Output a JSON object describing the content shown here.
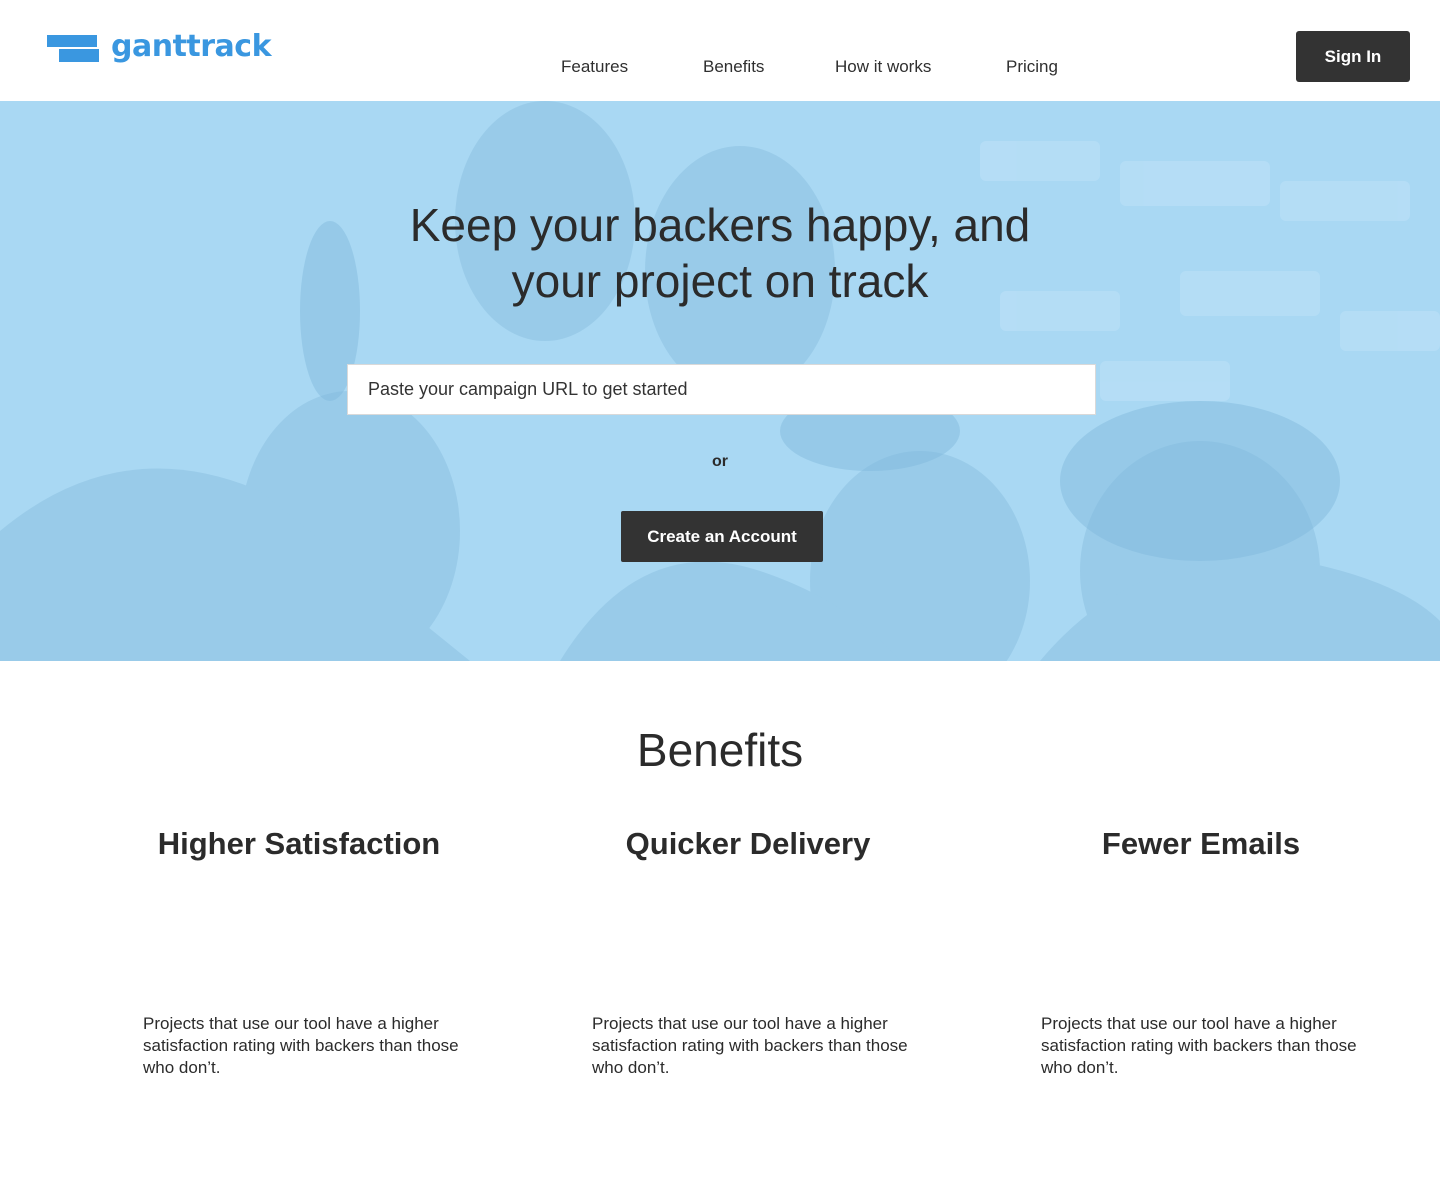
{
  "header": {
    "logo_text": "ganttrack",
    "nav": [
      {
        "label": "Features"
      },
      {
        "label": "Benefits"
      },
      {
        "label": "How it works"
      },
      {
        "label": "Pricing"
      }
    ],
    "signin_label": "Sign In"
  },
  "hero": {
    "title_line1": "Keep your backers happy, and",
    "title_line2": "your project on track",
    "input_placeholder": "Paste your campaign URL to get started",
    "or_text": "or",
    "cta_label": "Create an Account"
  },
  "benefits": {
    "title": "Benefits",
    "items": [
      {
        "heading": "Higher Satisfaction",
        "text": "Projects that use our tool have a higher satisfaction rating with backers than those who don’t."
      },
      {
        "heading": "Quicker Delivery",
        "text": "Projects that use our tool have a higher satisfaction rating with backers than those who don’t."
      },
      {
        "heading": "Fewer Emails",
        "text": "Projects that use our tool have a higher satisfaction rating with backers than those who don’t."
      }
    ]
  },
  "colors": {
    "brand": "#3a97e0",
    "hero_overlay": "#a6d6f2",
    "button_dark": "#333333"
  }
}
